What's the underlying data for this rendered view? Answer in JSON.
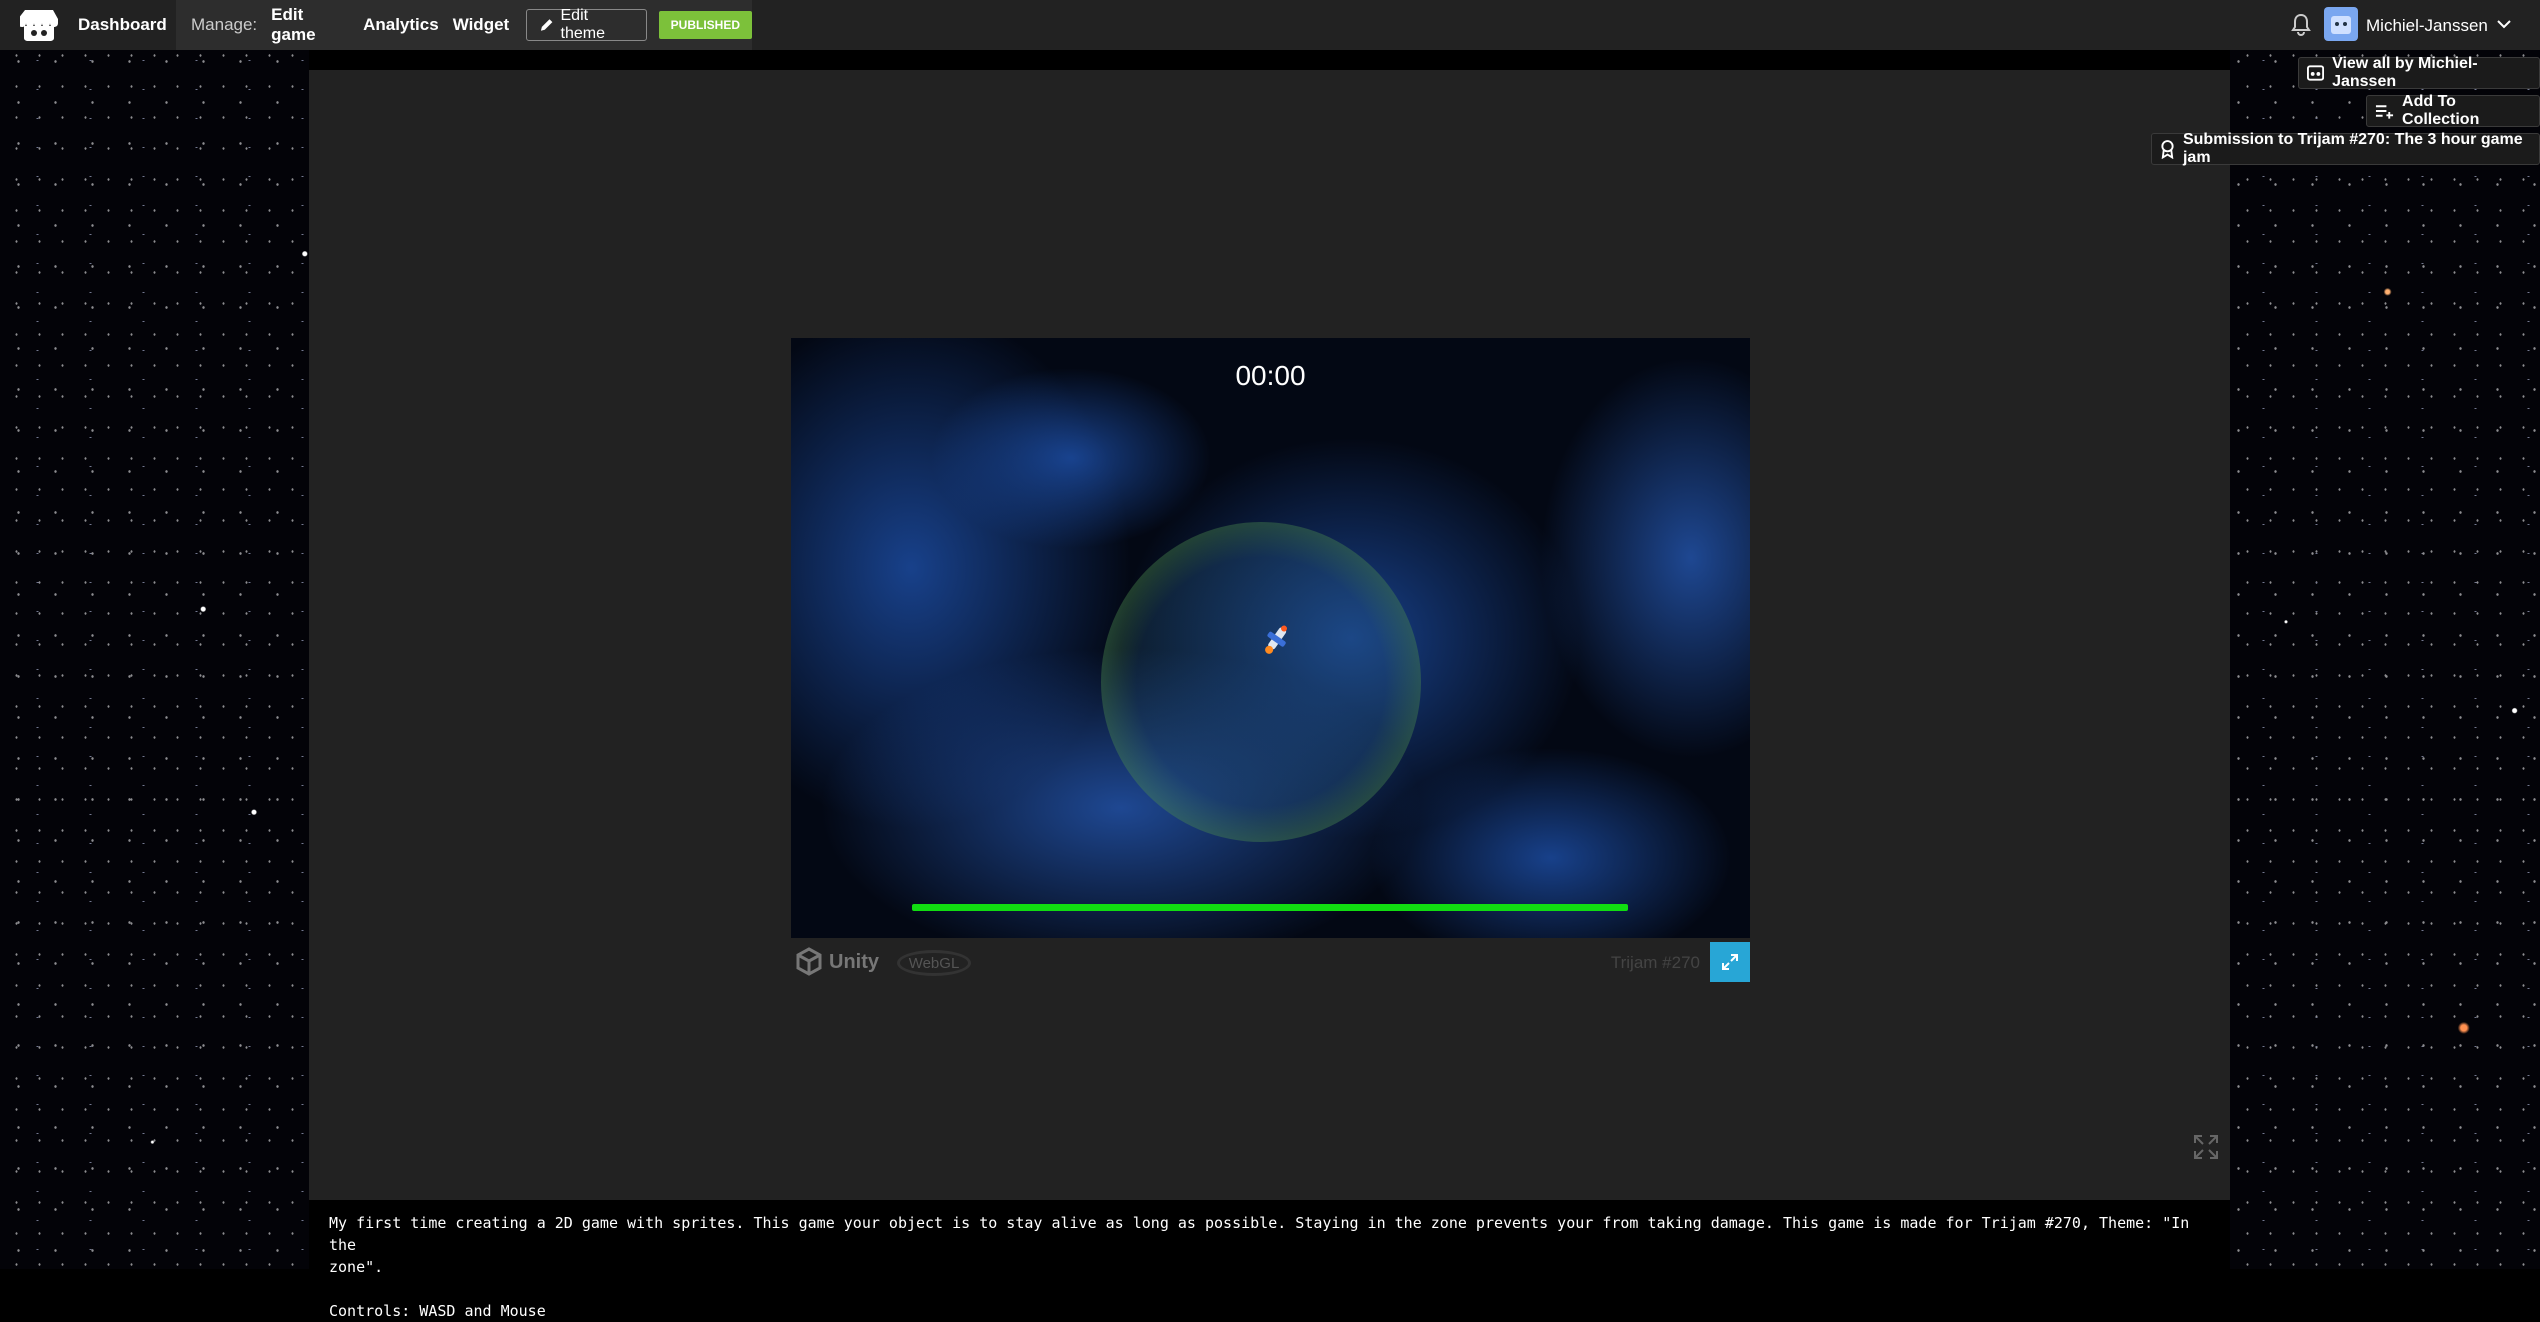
{
  "colors": {
    "topbar_bg": "#222222",
    "manage_bg": "#2d2d2d",
    "published_badge": "#7cc13a",
    "fullscreen_button": "#28a6d6",
    "health_bar": "#11dd11"
  },
  "topbar": {
    "dashboard_label": "Dashboard",
    "manage_label": "Manage:",
    "edit_game_label": "Edit game",
    "analytics_label": "Analytics",
    "widget_label": "Widget",
    "edit_theme_label": "Edit theme",
    "published_label": "PUBLISHED",
    "username": "Michiel-Janssen",
    "icons": [
      "itchio-logo-icon",
      "pencil-icon",
      "bell-icon",
      "avatar",
      "chevron-down-icon"
    ]
  },
  "side_actions": {
    "view_all_label": "View all by Michiel-Janssen",
    "add_collection_label": "Add To Collection",
    "submission_label": "Submission to Trijam #270: The 3 hour game jam"
  },
  "game": {
    "timer": "00:00",
    "health_fraction": 1.0,
    "engine_label": "Unity",
    "webgl_label": "WebGL",
    "title": "Trijam #270"
  },
  "description": {
    "line1": "My first time creating a 2D game with sprites. This game your object is to stay alive as long as possible. Staying in the zone prevents your from taking damage. This game is made for Trijam #270, Theme: \"In the",
    "line2": "zone\".",
    "line3": "Controls: WASD and Mouse"
  }
}
